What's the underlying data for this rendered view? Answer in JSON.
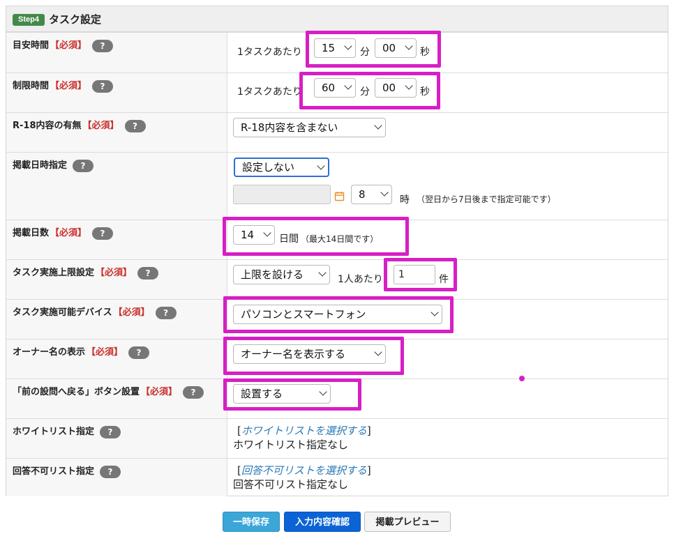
{
  "header": {
    "badge": "Step4",
    "title": "タスク設定"
  },
  "required_mark": "【必須】",
  "help_icon": "?",
  "rows": {
    "target_time": {
      "label": "目安時間",
      "prefix": "1タスクあたり",
      "minutes": "15",
      "min_unit": "分",
      "seconds": "00",
      "sec_unit": "秒"
    },
    "limit_time": {
      "label": "制限時間",
      "prefix": "1タスクあたり",
      "minutes": "60",
      "min_unit": "分",
      "seconds": "00",
      "sec_unit": "秒"
    },
    "r18": {
      "label": "R-18内容の有無",
      "value": "R-18内容を含まない"
    },
    "publish_datetime": {
      "label": "掲載日時指定",
      "value": "設定しない",
      "date_value": "",
      "hour": "8",
      "hour_unit": "時",
      "note": "（翌日から7日後まで指定可能です）"
    },
    "publish_days": {
      "label": "掲載日数",
      "value": "14",
      "unit": "日間",
      "note": "（最大14日間です）"
    },
    "task_limit": {
      "label": "タスク実施上限設定",
      "value": "上限を設ける",
      "per_person": "1人あたり",
      "count": "1",
      "count_unit": "件"
    },
    "devices": {
      "label": "タスク実施可能デバイス",
      "value": "パソコンとスマートフォン"
    },
    "owner_name": {
      "label": "オーナー名の表示",
      "value": "オーナー名を表示する"
    },
    "back_button": {
      "label": "「前の設問へ戻る」ボタン設置",
      "value": "設置する"
    },
    "whitelist": {
      "label": "ホワイトリスト指定",
      "bracket_open": "[",
      "link": "ホワイトリストを選択する",
      "bracket_close": "]",
      "status": "ホワイトリスト指定なし"
    },
    "blacklist": {
      "label": "回答不可リスト指定",
      "bracket_open": "[",
      "link": "回答不可リストを選択する",
      "bracket_close": "]",
      "status": "回答不可リスト指定なし"
    }
  },
  "buttons": {
    "save_draft": "一時保存",
    "confirm": "入力内容確認",
    "preview": "掲載プレビュー"
  },
  "colors": {
    "highlight": "#d71fc4",
    "required": "#c9302c",
    "badge": "#45894a",
    "link": "#2a7ab5",
    "primary_button": "#0b63d6",
    "info_button": "#3ba6d8"
  }
}
